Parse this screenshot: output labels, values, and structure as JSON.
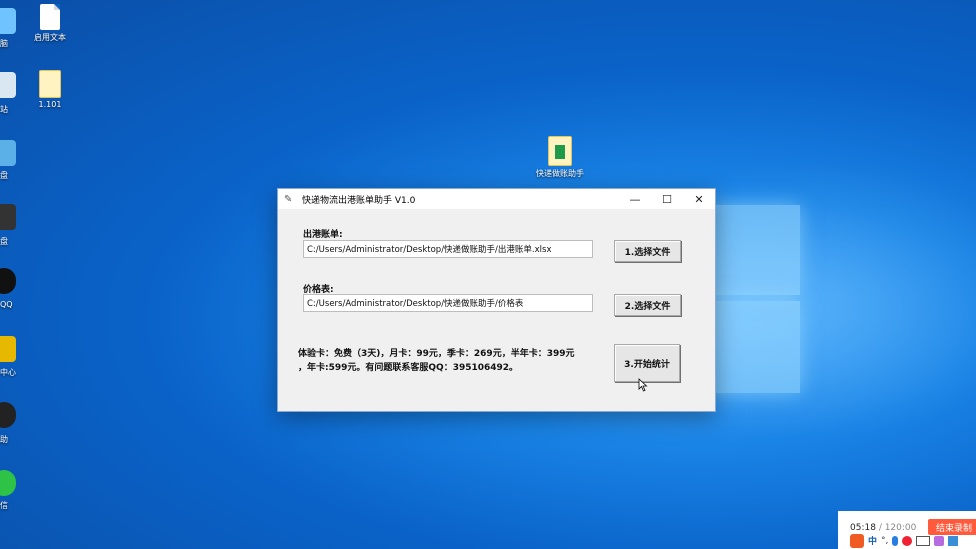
{
  "desktop": {
    "icons": [
      {
        "label": "启用文本",
        "icon": "blank-document-icon"
      },
      {
        "label": "1.101",
        "icon": "folder-file-icon"
      },
      {
        "label": "快递做账助手",
        "icon": "folder-file-icon"
      }
    ],
    "left_edge_labels": [
      "脑",
      "站",
      "盘",
      "盘",
      "QQ",
      "中心",
      "助",
      "信"
    ]
  },
  "window": {
    "title": "快递物流出港账单助手 V1.0",
    "minimize_glyph": "—",
    "maximize_glyph": "☐",
    "close_glyph": "✕",
    "bill_label": "出港账单:",
    "bill_path": "C:/Users/Administrator/Desktop/快递做账助手/出港账单.xlsx",
    "select_button_1": "1.选择文件",
    "price_label": "价格表:",
    "price_path": "C:/Users/Administrator/Desktop/快递做账助手/价格表",
    "select_button_2": "2.选择文件",
    "info_line_1": "体验卡：免费（3天)，月卡：99元，季卡：269元，半年卡：399元",
    "info_line_2": "，年卡:599元。有问题联系客服QQ：395106492。",
    "start_button": "3.开始统计"
  },
  "recorder": {
    "elapsed": "05:18",
    "total": "/ 120:00",
    "stop_label": "结束录制"
  },
  "taskbar_ime": {
    "lang": "中",
    "punct": "°,"
  },
  "colors": {
    "desktop": "#0a63c9",
    "window_bg": "#f0f0f0",
    "recorder_stop": "#ff5a3c"
  }
}
